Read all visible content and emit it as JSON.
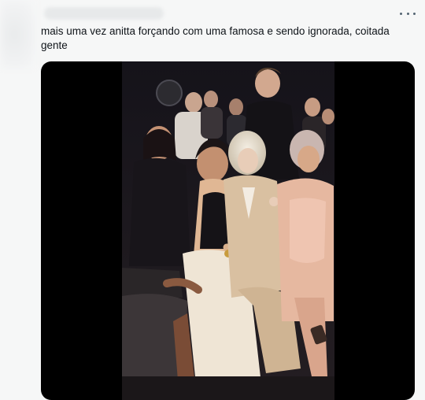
{
  "tweet": {
    "text": "mais uma vez anitta forçando com uma famosa e sendo ignorada, coitada gente"
  },
  "header": {
    "more_icon": "more-horizontal-icon"
  },
  "media": {
    "type": "video-frame",
    "background": "#000000"
  }
}
